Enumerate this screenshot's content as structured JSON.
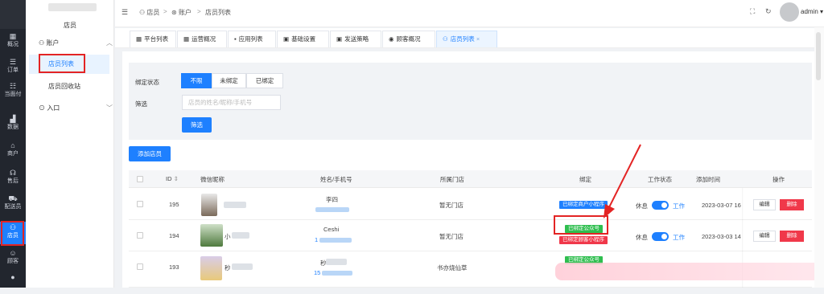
{
  "leftnav": {
    "items": [
      {
        "icon": "overview-icon",
        "glyph": "▦",
        "label": "概况"
      },
      {
        "icon": "orders-icon",
        "glyph": "☰",
        "label": "订单"
      },
      {
        "icon": "pay-icon",
        "glyph": "☷",
        "label": "当面付"
      },
      {
        "icon": "data-icon",
        "glyph": "▟",
        "label": "数据"
      },
      {
        "icon": "shop-icon",
        "glyph": "⌂",
        "label": "商户"
      },
      {
        "icon": "after-sales-icon",
        "glyph": "☊",
        "label": "售后"
      },
      {
        "icon": "delivery-icon",
        "glyph": "⛟",
        "label": "配送员"
      },
      {
        "icon": "staff-icon",
        "glyph": "⚇",
        "label": "店员"
      },
      {
        "icon": "customer-icon",
        "glyph": "☺",
        "label": "顾客"
      },
      {
        "icon": "chat-icon",
        "glyph": "●",
        "label": ""
      }
    ]
  },
  "sidebar": {
    "title": "店员",
    "group_account": "账户",
    "items": [
      "店员列表",
      "店员回收站"
    ],
    "group_entry": "入口"
  },
  "topbar": {
    "breadcrumb": [
      "店员",
      "账户",
      "店员列表"
    ],
    "user": "admin"
  },
  "tabs": [
    "平台列表",
    "运营概况",
    "应用列表",
    "基础设置",
    "发送策略",
    "顾客概况",
    "店员列表"
  ],
  "filter": {
    "bind_label": "绑定状态",
    "bind_options": [
      "不限",
      "未绑定",
      "已绑定"
    ],
    "filter_label": "筛选",
    "search_placeholder": "店员的姓名/昵称/手机号",
    "filter_button": "筛选"
  },
  "add_button": "添加店员",
  "table": {
    "columns": [
      "ID",
      "微信昵称",
      "姓名/手机号",
      "所属门店",
      "绑定",
      "工作状态",
      "添加时间",
      "操作"
    ],
    "rows": [
      {
        "id": "195",
        "name": "李四",
        "store": "暂无门店",
        "tags": [
          "已绑定商户小程序"
        ],
        "rest": "休息",
        "work": "工作",
        "time": "2023-03-07 16"
      },
      {
        "id": "194",
        "nickname": "小",
        "name": "Ceshi",
        "phone": "1",
        "store": "暂无门店",
        "tags": [
          "已绑定公众号",
          "已绑定顾客小程序"
        ],
        "rest": "休息",
        "work": "工作",
        "time": "2023-03-03 14"
      },
      {
        "id": "193",
        "nickname": "秒",
        "name": "秒",
        "phone": "15",
        "store": "书亦烧仙草",
        "tags": [
          "已绑定公众号"
        ],
        "rest": "",
        "work": "",
        "time": ""
      }
    ],
    "edit": "编辑",
    "delete": "删除"
  },
  "colors": {
    "accent": "#1e80ff",
    "danger": "#f0384a",
    "success": "#2fbe4f",
    "annotation": "#e32424"
  }
}
